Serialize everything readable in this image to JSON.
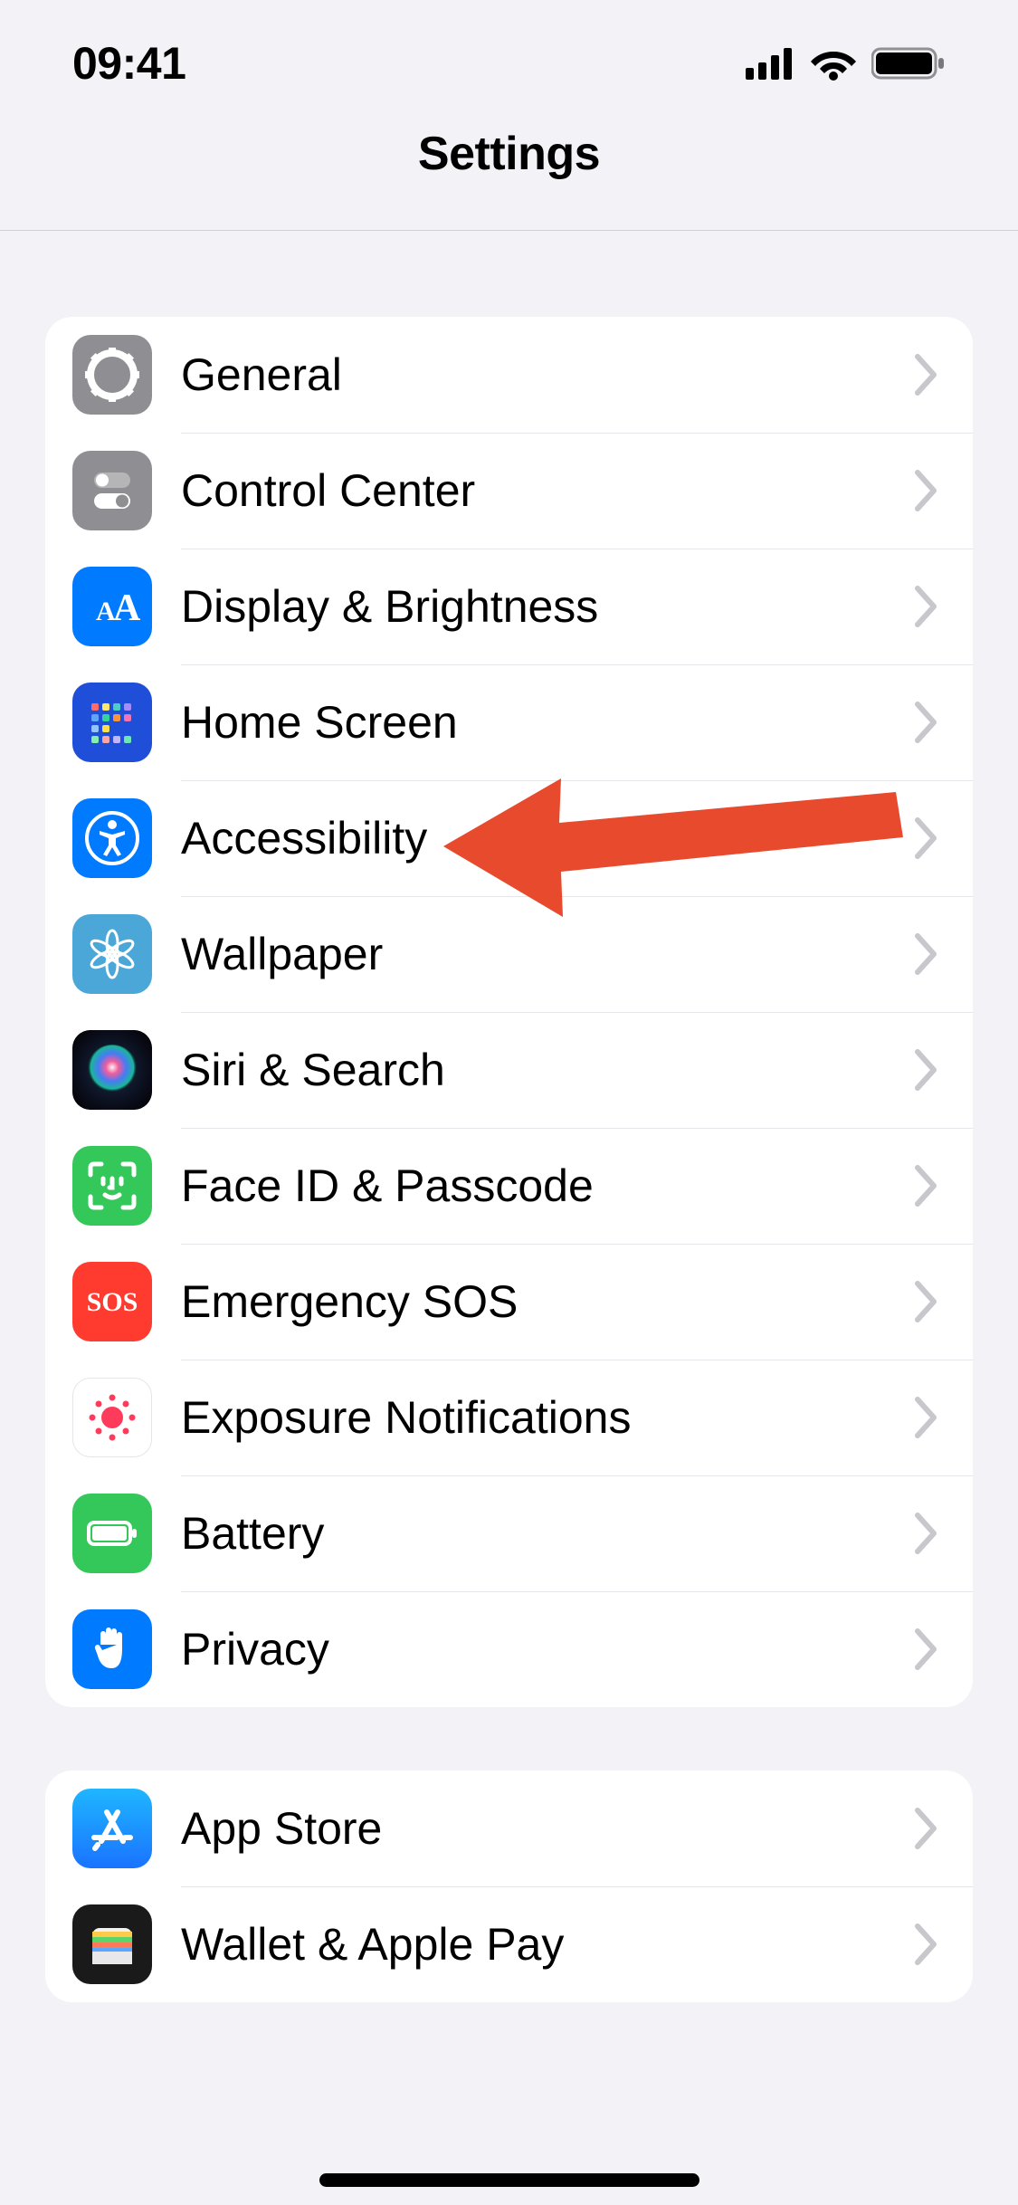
{
  "status_bar": {
    "time": "09:41"
  },
  "header": {
    "title": "Settings"
  },
  "groups": [
    {
      "items": [
        {
          "id": "general",
          "label": "General"
        },
        {
          "id": "control-center",
          "label": "Control Center"
        },
        {
          "id": "display-brightness",
          "label": "Display & Brightness"
        },
        {
          "id": "home-screen",
          "label": "Home Screen"
        },
        {
          "id": "accessibility",
          "label": "Accessibility"
        },
        {
          "id": "wallpaper",
          "label": "Wallpaper"
        },
        {
          "id": "siri-search",
          "label": "Siri & Search"
        },
        {
          "id": "face-id-passcode",
          "label": "Face ID & Passcode"
        },
        {
          "id": "emergency-sos",
          "label": "Emergency SOS"
        },
        {
          "id": "exposure-notifications",
          "label": "Exposure Notifications"
        },
        {
          "id": "battery",
          "label": "Battery"
        },
        {
          "id": "privacy",
          "label": "Privacy"
        }
      ]
    },
    {
      "items": [
        {
          "id": "app-store",
          "label": "App Store"
        },
        {
          "id": "wallet-apple-pay",
          "label": "Wallet & Apple Pay"
        }
      ]
    }
  ],
  "annotation": {
    "color": "#e84a2e",
    "target": "accessibility"
  },
  "colors": {
    "gray": "#8e8e93",
    "blue": "#007aff",
    "deep_blue": "#1f4fd8",
    "bright_blue": "#2f7af6",
    "teal_blue": "#4aa7d8",
    "green": "#34c759",
    "red": "#ff3b30",
    "white": "#ffffff"
  }
}
